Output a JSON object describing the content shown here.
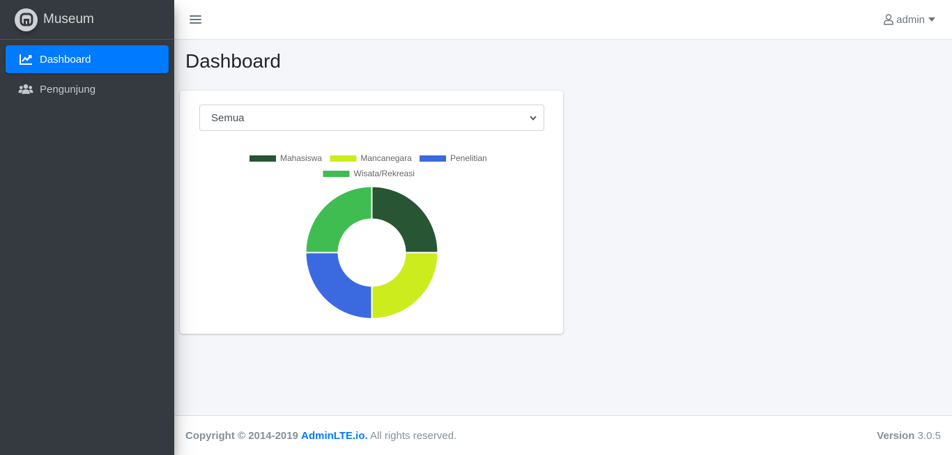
{
  "brand": {
    "name": "Museum",
    "logo_icon": "adminlte-logo-icon"
  },
  "sidebar": {
    "items": [
      {
        "label": "Dashboard",
        "icon": "chart-line-icon",
        "active": true
      },
      {
        "label": "Pengunjung",
        "icon": "users-icon",
        "active": false
      }
    ]
  },
  "navbar": {
    "user_label": "admin"
  },
  "page": {
    "title": "Dashboard"
  },
  "filter": {
    "selected": "Semua"
  },
  "colors": {
    "accent": "#007bff",
    "sidebar_bg": "#343a40"
  },
  "chart_data": {
    "type": "pie",
    "variant": "doughnut",
    "legend_position": "top",
    "labels": [
      "Mahasiswa",
      "Mancanegara",
      "Penelitian",
      "Wisata/Rekreasi"
    ],
    "values": [
      25,
      25,
      25,
      25
    ],
    "colors": [
      "#285533",
      "#cdec1e",
      "#3b6ae0",
      "#3fbd51"
    ]
  },
  "footer": {
    "copyright": "Copyright © 2014-2019",
    "link": "AdminLTE.io.",
    "rights": "All rights reserved.",
    "version_label": "Version",
    "version": "3.0.5"
  }
}
